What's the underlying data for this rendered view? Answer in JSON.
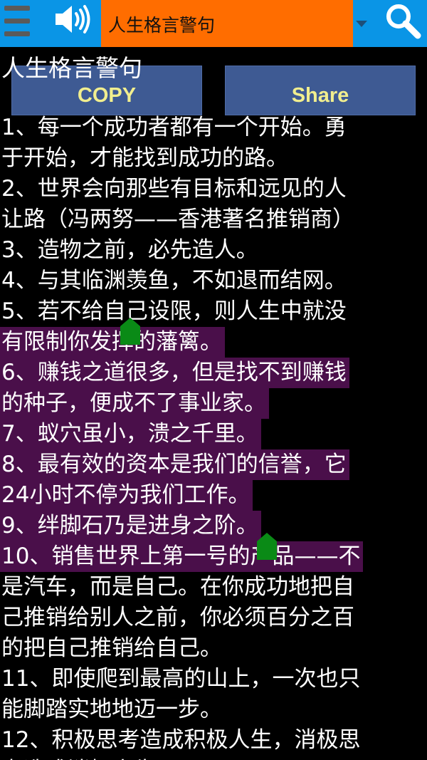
{
  "toolbar": {
    "menu_icon": "hamburger-menu-icon",
    "speaker_icon": "speaker-volume-icon",
    "selected_title": "人生格言警句",
    "dropdown_icon": "dropdown-arrow-icon",
    "search_icon": "magnifier-search-icon"
  },
  "content": {
    "title": "人生格言警句",
    "copy_label": "COPY",
    "share_label": "Share",
    "lines": [
      "1、每一个成功者都有一个开始。勇",
      "于开始，才能找到成功的路。",
      "2、世界会向那些有目标和远见的人",
      "让路（冯两努——香港著名推销商）",
      "3、造物之前，必先造人。",
      "4、与其临渊羡鱼，不如退而结网。",
      "5、若不给自己设限，则人生中就没",
      "有限制你发挥的藩篱。",
      "6、赚钱之道很多，但是找不到赚钱",
      "的种子，便成不了事业家。",
      "7、蚁穴虽小，溃之千里。",
      "8、最有效的资本是我们的信誉，它",
      "24小时不停为我们工作。",
      "9、绊脚石乃是进身之阶。",
      "10、销售世界上第一号的产品——不",
      "是汽车，而是自己。在你成功地把自",
      "己推销给别人之前，你必须百分之百",
      "的把自己推销给自己。",
      "11、即使爬到最高的山上，一次也只",
      "能脚踏实地地迈一步。",
      "12、积极思考造成积极人生，消极思",
      "考造成消极人生。"
    ],
    "selection_start_line": 7,
    "selection_end_line": 14,
    "selection_color": "#4a0f4a",
    "handle_color": "#0a8a16"
  },
  "colors": {
    "topbar": "#0a95e6",
    "title_select": "#ff6d00",
    "button_bg": "#3e5a93",
    "button_text": "#f1ee8e"
  }
}
